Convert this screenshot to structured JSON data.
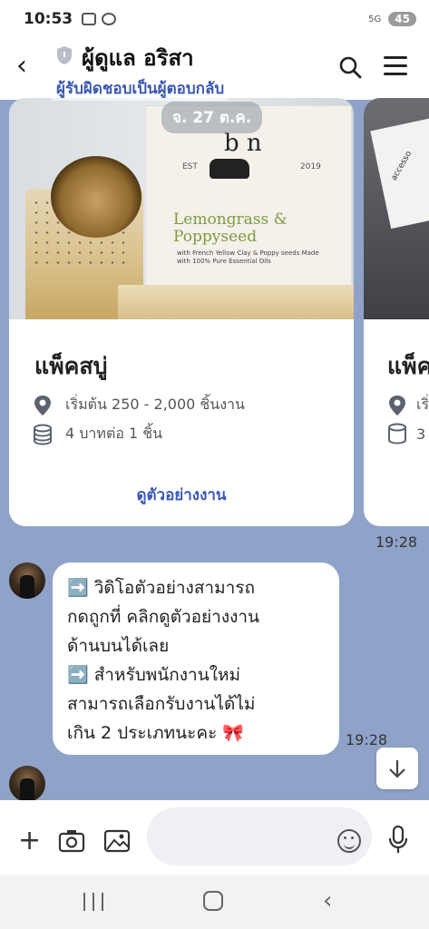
{
  "status_bar": {
    "time": "10:53",
    "signal": "5G",
    "battery": "45"
  },
  "header": {
    "back_label": "‹",
    "title": "ผู้ดูแล อริสา",
    "subtitle": "ผู้รับผิดชอบเป็นผู้ตอบกลับ"
  },
  "date_pill": "จ. 27 ต.ค.",
  "cards": [
    {
      "image_brand_letters": "b n",
      "image_est": "EST",
      "image_year": "2019",
      "image_product": "Lemongrass & Poppyseed",
      "image_small_text": "with French Yellow Clay & Poppy seeds Made with 100% Pure Essential Oils",
      "title": "แพ็คสบู่",
      "price_range": "เริ่มต้น 250 - 2,000 ชิ้นงาน",
      "rate": "4 บาทต่อ 1 ชิ้น",
      "link": "ดูตัวอย่างงาน"
    },
    {
      "image_tag_text": "accesso",
      "title": "แพ็ค",
      "price_range": "เริ่",
      "rate": "3"
    }
  ],
  "card_time": "19:28",
  "message": {
    "lines": [
      "➡️ วิดิโอตัวอย่างสามารถ",
      "กดถูกที่ คลิกดูตัวอย่างงาน",
      "ด้านบนได้เลย",
      "➡️ สำหรับพนักงานใหม่",
      "สามารถเลือกรับงานได้ไม่",
      "เกิน 2 ประเภทนะคะ 🎀"
    ],
    "time": "19:28"
  },
  "input": {
    "placeholder": ""
  },
  "icons": {
    "back": "back-icon",
    "shield": "shield-icon",
    "search": "search-icon",
    "menu": "menu-icon",
    "location": "location-pin-icon",
    "coins": "coins-icon",
    "scroll": "scroll-down-icon",
    "plus": "plus-icon",
    "camera": "camera-icon",
    "image": "image-icon",
    "emoji": "emoji-icon",
    "mic": "mic-icon"
  },
  "colors": {
    "chat_bg": "#8fa3c9",
    "accent": "#3a57b3",
    "bubble": "#ffffff"
  }
}
